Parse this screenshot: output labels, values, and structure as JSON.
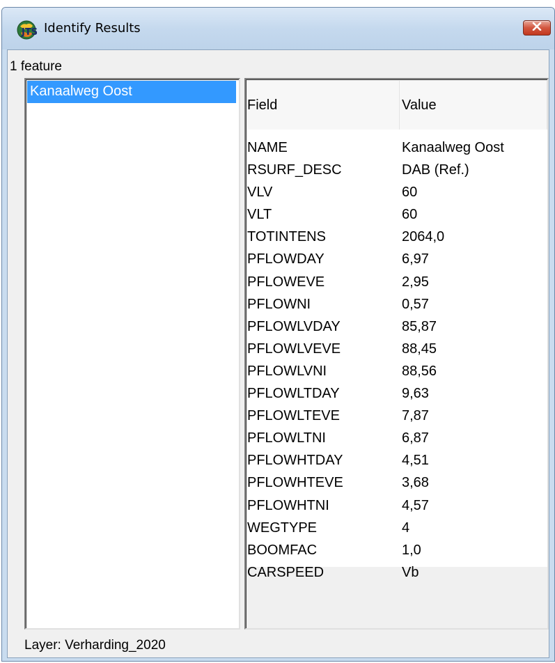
{
  "window": {
    "title": "Identify Results"
  },
  "feature_count": "1 feature",
  "features": [
    "Kanaalweg Oost"
  ],
  "table": {
    "headers": {
      "field": "Field",
      "value": "Value"
    },
    "rows": [
      {
        "field": "NAME",
        "value": "Kanaalweg Oost"
      },
      {
        "field": "RSURF_DESC",
        "value": "DAB (Ref.)"
      },
      {
        "field": "VLV",
        "value": "60"
      },
      {
        "field": "VLT",
        "value": "60"
      },
      {
        "field": "TOTINTENS",
        "value": "2064,0"
      },
      {
        "field": "PFLOWDAY",
        "value": "6,97"
      },
      {
        "field": "PFLOWEVE",
        "value": "2,95"
      },
      {
        "field": "PFLOWNI",
        "value": "0,57"
      },
      {
        "field": "PFLOWLVDAY",
        "value": "85,87"
      },
      {
        "field": "PFLOWLVEVE",
        "value": "88,45"
      },
      {
        "field": "PFLOWLVNI",
        "value": "88,56"
      },
      {
        "field": "PFLOWLTDAY",
        "value": "9,63"
      },
      {
        "field": "PFLOWLTEVE",
        "value": "7,87"
      },
      {
        "field": "PFLOWLTNI",
        "value": "6,87"
      },
      {
        "field": "PFLOWHTDAY",
        "value": "4,51"
      },
      {
        "field": "PFLOWHTEVE",
        "value": "3,68"
      },
      {
        "field": "PFLOWHTNI",
        "value": "4,57"
      },
      {
        "field": "WEGTYPE",
        "value": "4"
      },
      {
        "field": "BOOMFAC",
        "value": "1,0"
      },
      {
        "field": "CARSPEED",
        "value": "Vb"
      }
    ]
  },
  "layer_label": "Layer: Verharding_2020",
  "icons": {
    "app": "jts-app-icon",
    "close": "close-icon"
  },
  "colors": {
    "selection": "#3399ff",
    "close_button": "#c2381f",
    "titlebar": "#c5d9ee"
  }
}
